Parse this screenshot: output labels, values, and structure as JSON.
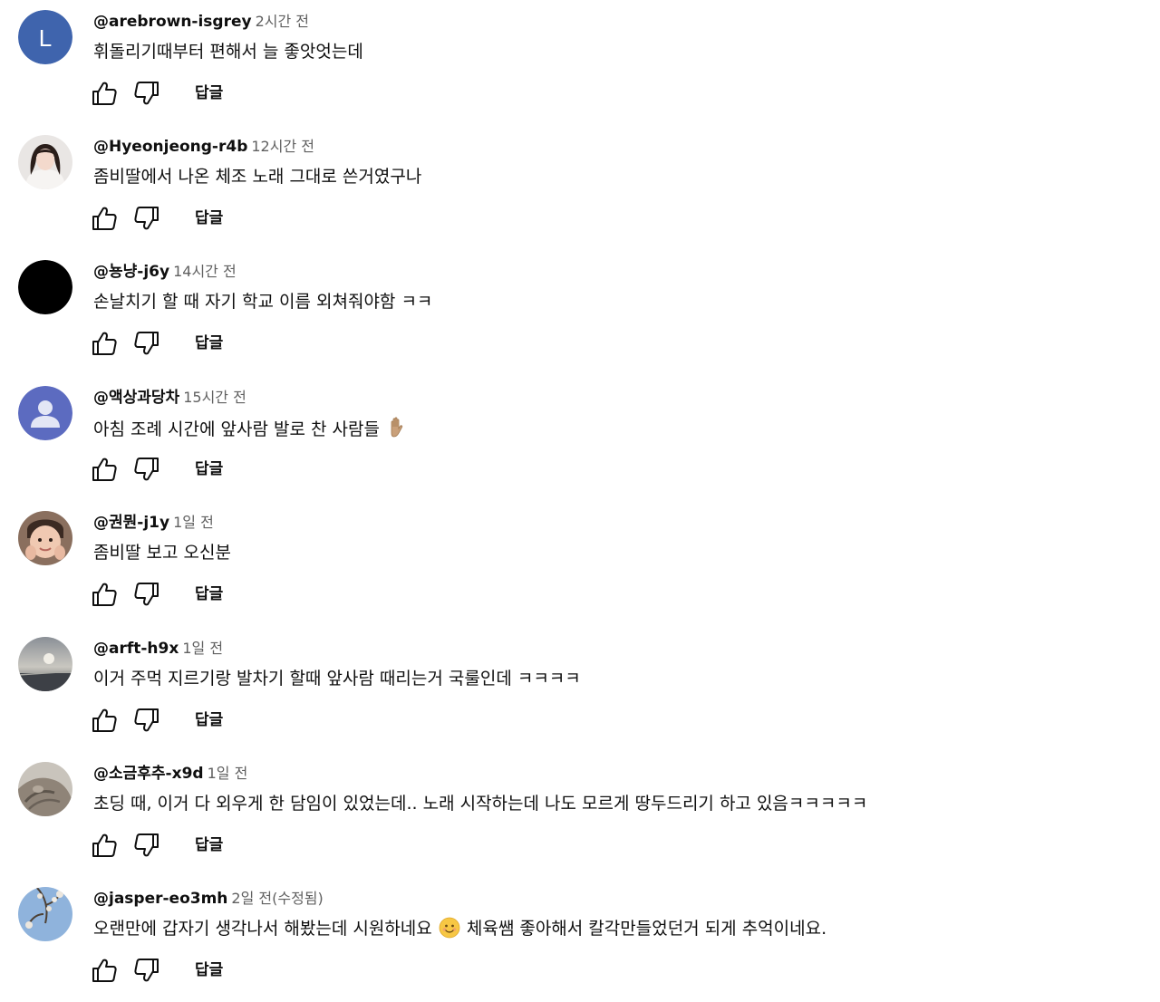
{
  "comments": [
    {
      "author": "@arebrown-isgrey",
      "time": "2시간 전",
      "text": "휘돌리기때부터 편해서 늘 좋앗엇는데",
      "reply": "답글",
      "avatar": {
        "type": "letter",
        "letter": "L",
        "bg": "#3f64ad"
      }
    },
    {
      "author": "@Hyeonjeong-r4b",
      "time": "12시간 전",
      "text": "좀비딸에서 나온 체조 노래 그대로 쓴거였구나",
      "reply": "답글",
      "avatar": {
        "type": "photo",
        "icon": "woman-portrait-avatar"
      }
    },
    {
      "author": "@뇽냥-j6y",
      "time": "14시간 전",
      "text": "손날치기 할 때 자기 학교 이름 외쳐줘야함 ㅋㅋ",
      "reply": "답글",
      "avatar": {
        "type": "solid",
        "bg": "#000000"
      }
    },
    {
      "author": "@액상과당차",
      "time": "15시간 전",
      "text": "아침 조례 시간에 앞사람 발로 찬 사람들",
      "text_emoji": "raised-hand-emoji",
      "reply": "답글",
      "avatar": {
        "type": "default-person",
        "bg": "#5c6bc0"
      }
    },
    {
      "author": "@권뭔-j1y",
      "time": "1일 전",
      "text": "좀비딸 보고 오신분",
      "reply": "답글",
      "avatar": {
        "type": "photo",
        "icon": "baby-portrait-avatar"
      }
    },
    {
      "author": "@arft-h9x",
      "time": "1일 전",
      "text": "이거 주먹 지르기랑 발차기 할때 앞사람 때리는거 국룰인데 ㅋㅋㅋㅋ",
      "reply": "답글",
      "avatar": {
        "type": "photo",
        "icon": "sunset-landscape-avatar"
      }
    },
    {
      "author": "@소금후추-x9d",
      "time": "1일 전",
      "text": "초딩 때, 이거 다 외우게 한 담임이 있었는데.. 노래 시작하는데 나도 모르게 땅두드리기 하고 있음ㅋㅋㅋㅋㅋ",
      "reply": "답글",
      "avatar": {
        "type": "photo",
        "icon": "cat-photo-avatar"
      }
    },
    {
      "author": "@jasper-eo3mh",
      "time": "2일 전(수정됨)",
      "text": "오랜만에 갑자기 생각나서 해봤는데 시원하네요",
      "text_emoji": "smiling-face-emoji",
      "text_after": "체육쌤 좋아해서 칼각만들었던거 되게 추억이네요.",
      "reply": "답글",
      "avatar": {
        "type": "photo",
        "icon": "blossom-sky-avatar"
      }
    }
  ]
}
